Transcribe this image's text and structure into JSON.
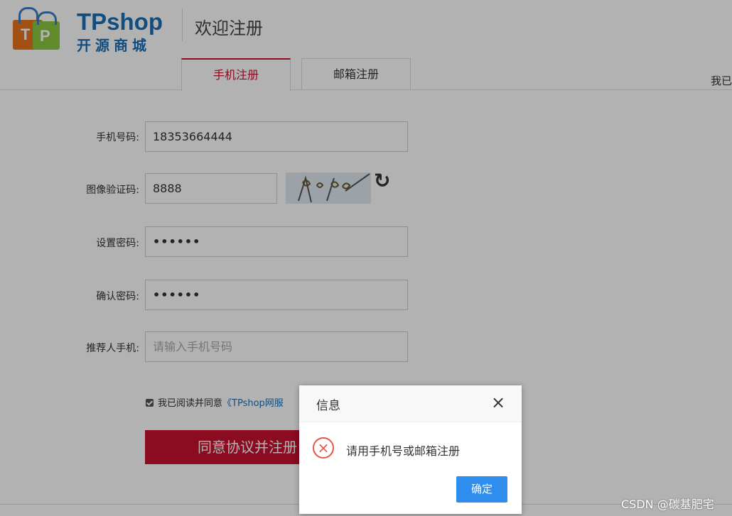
{
  "header": {
    "logo_letters": [
      "T",
      "P"
    ],
    "logo_title": "TPshop",
    "logo_subtitle": "开源商城",
    "welcome": "欢迎注册",
    "login_link": "我已"
  },
  "tabs": [
    {
      "label": "手机注册",
      "active": true
    },
    {
      "label": "邮箱注册",
      "active": false
    }
  ],
  "form": {
    "phone": {
      "label": "手机号码:",
      "value": "18353664444"
    },
    "captcha": {
      "label": "图像验证码:",
      "value": "8888"
    },
    "password": {
      "label": "设置密码:",
      "value": "••••••"
    },
    "confirm": {
      "label": "确认密码:",
      "value": "••••••"
    },
    "referrer": {
      "label": "推荐人手机:",
      "placeholder": "请输入手机号码"
    },
    "agree_text": "我已阅读并同意",
    "agree_link": "《TPshop网服",
    "submit_label": "同意协议并注册"
  },
  "dialog": {
    "title": "信息",
    "message": "请用手机号或邮箱注册",
    "ok_label": "确定",
    "close_icon": "×",
    "error_icon": "×"
  },
  "watermark": "CSDN @碳基肥宅",
  "colors": {
    "brand_red": "#c8102e",
    "brand_blue": "#1a6fb8",
    "dialog_button": "#2e8ded",
    "error": "#e25745"
  }
}
